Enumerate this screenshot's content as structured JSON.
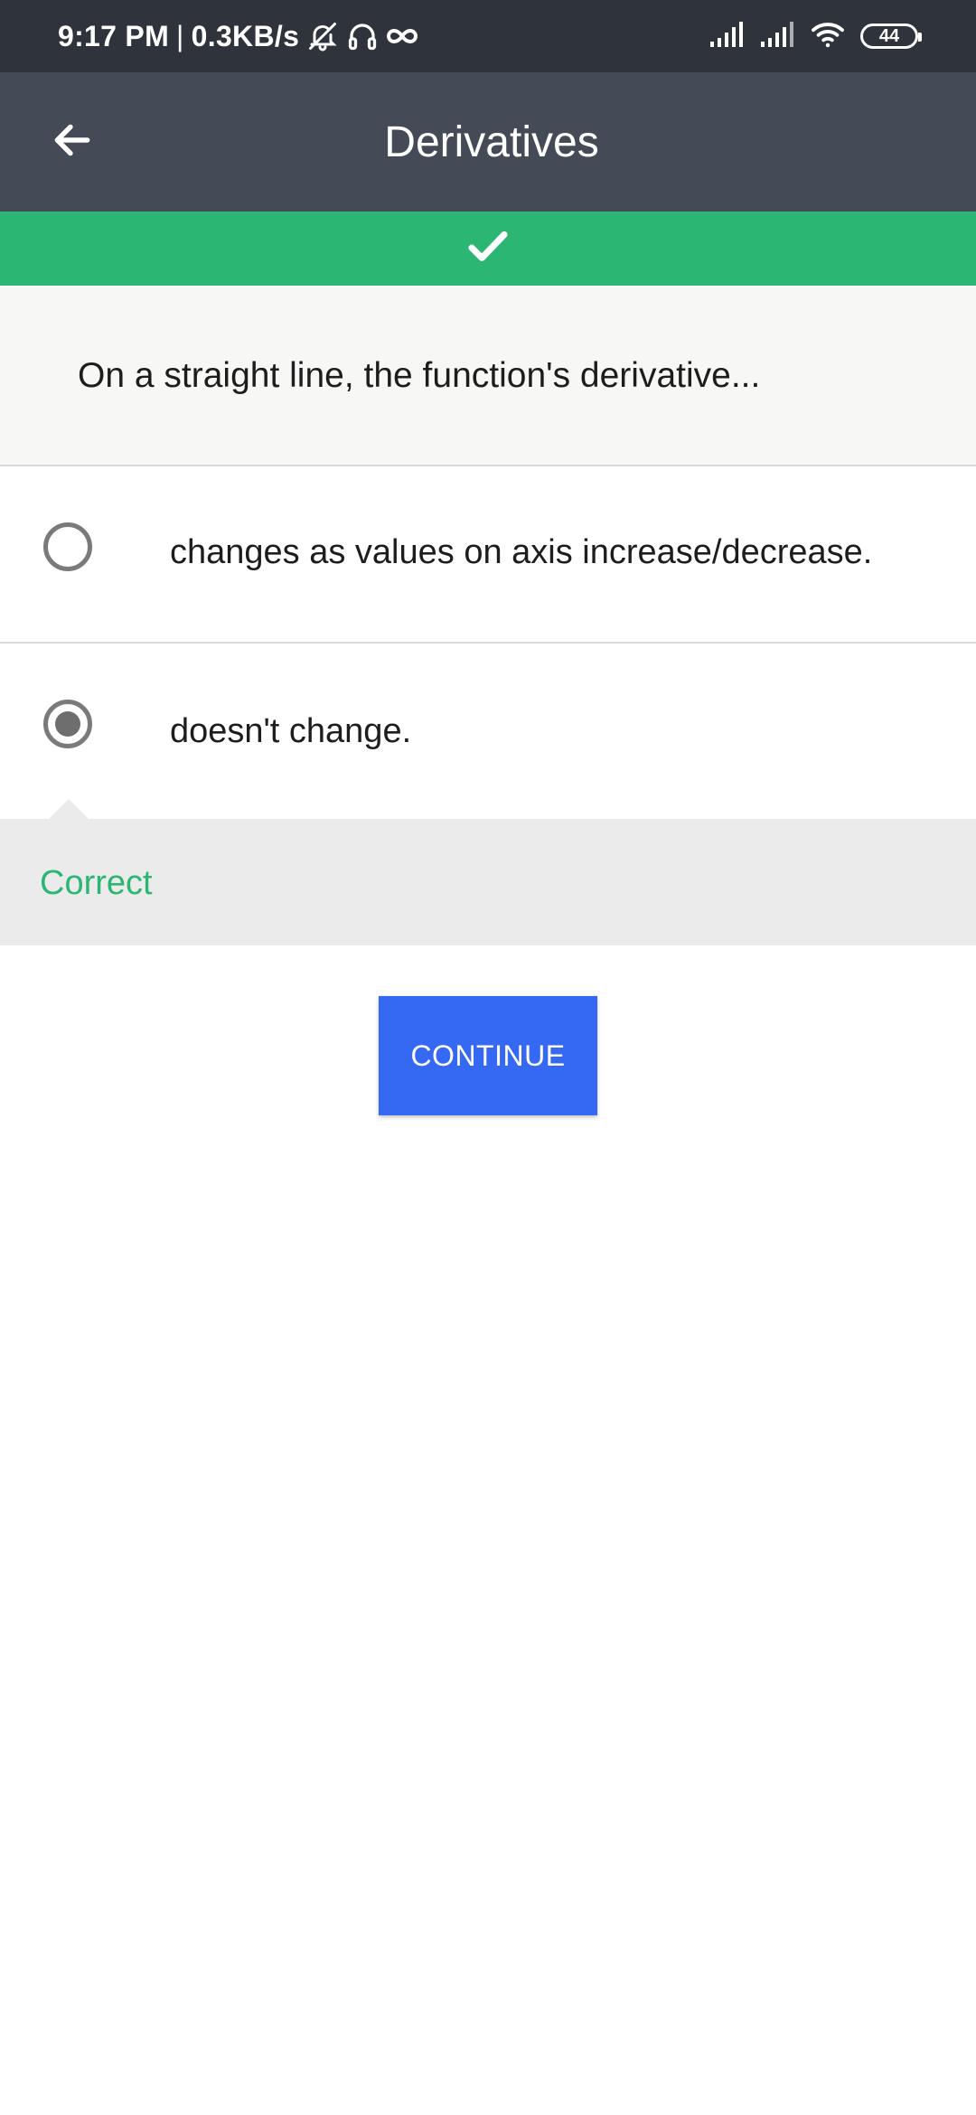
{
  "status_bar": {
    "time": "9:17 PM",
    "separator": "|",
    "speed": "0.3KB/s",
    "battery": "44",
    "icons": [
      "bell-off-icon",
      "headset-icon",
      "infinity-icon",
      "signal-icon",
      "signal-icon",
      "wifi-icon",
      "battery-icon"
    ]
  },
  "app_bar": {
    "title": "Derivatives",
    "back_icon": "arrow-left-icon"
  },
  "result_banner": {
    "icon": "checkmark-icon",
    "color": "#2bb673"
  },
  "question": {
    "text": "On a straight line, the function's derivative..."
  },
  "options": [
    {
      "label": "changes as values on axis increase/decrease.",
      "selected": false
    },
    {
      "label": "doesn't change.",
      "selected": true
    }
  ],
  "feedback": {
    "text": "Correct",
    "color": "#2bb673"
  },
  "continue_button": {
    "label": "CONTINUE",
    "color": "#3568f3"
  }
}
